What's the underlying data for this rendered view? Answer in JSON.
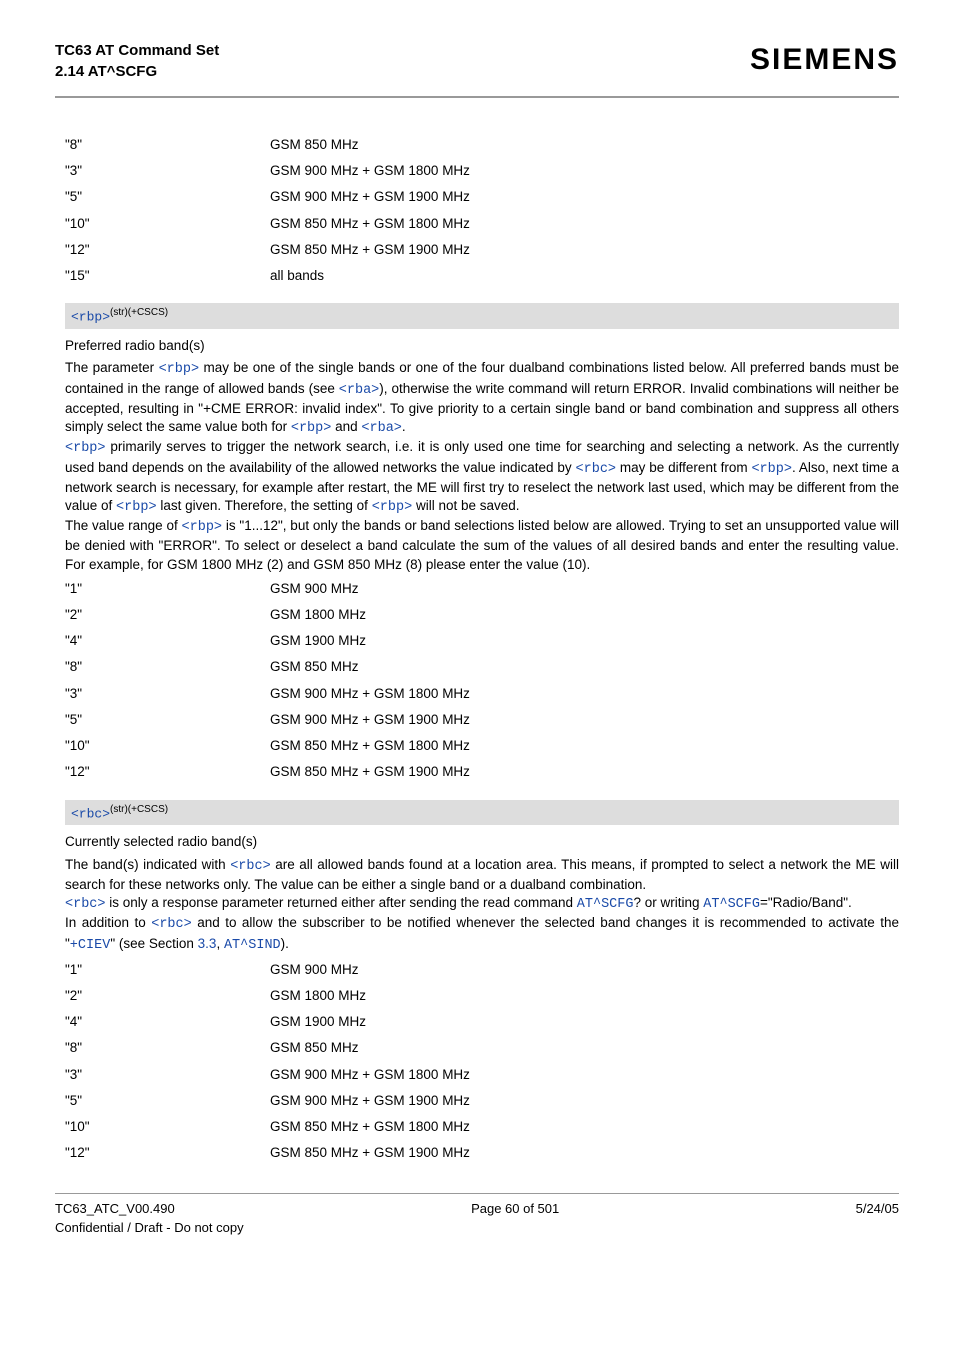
{
  "header": {
    "title1": "TC63 AT Command Set",
    "title2": "2.14 AT^SCFG",
    "brand": "SIEMENS"
  },
  "top_bands": [
    {
      "k": "\"8\"",
      "v": "GSM 850 MHz"
    },
    {
      "k": "\"3\"",
      "v": "GSM 900 MHz + GSM 1800 MHz"
    },
    {
      "k": "\"5\"",
      "v": "GSM 900 MHz + GSM 1900 MHz"
    },
    {
      "k": "\"10\"",
      "v": "GSM 850 MHz + GSM 1800 MHz"
    },
    {
      "k": "\"12\"",
      "v": "GSM 850 MHz + GSM 1900 MHz"
    },
    {
      "k": "\"15\"",
      "v": "all bands"
    }
  ],
  "rbp": {
    "param": "<rbp>",
    "sup": "(str)(+CSCS)",
    "title": "Preferred radio band(s)",
    "p1a": "The parameter ",
    "p1b": " may be one of the single bands or one of the four dualband combinations listed below. All preferred bands must be contained in the range of allowed bands (see ",
    "p1c": "), otherwise the write command will return ERROR. Invalid combinations will neither be accepted, resulting in \"+CME ERROR: invalid index\". To give priority to a certain single band or band combination and suppress all others simply select the same value both for ",
    "p1d": " and ",
    "p1e": ".",
    "p2a": " primarily serves to trigger the network search, i.e. it is only used one time for searching and selecting a network. As the currently used band depends on the availability of the allowed networks the value indicated by ",
    "p2b": " may be different from ",
    "p2c": ". Also, next time a network search is necessary, for example after restart, the ME will first try to reselect the network last used, which may be different from the value of ",
    "p2d": " last given. Therefore, the setting of ",
    "p2e": " will not be saved.",
    "p3a": "The value range of ",
    "p3b": " is \"1...12\", but only the bands or band selections listed below are allowed. Trying to set an unsupported value will be denied with \"ERROR\". To select or deselect a band calculate the sum of the values of all desired bands and enter the resulting value. For example, for GSM 1800 MHz (2) and GSM 850 MHz (8) please enter the value (10).",
    "rbp_ref": "<rbp>",
    "rba_ref": "<rba>",
    "rbc_ref": "<rbc>",
    "bands": [
      {
        "k": "\"1\"",
        "v": "GSM 900 MHz"
      },
      {
        "k": "\"2\"",
        "v": "GSM 1800 MHz"
      },
      {
        "k": "\"4\"",
        "v": "GSM 1900 MHz"
      },
      {
        "k": "\"8\"",
        "v": "GSM 850 MHz"
      },
      {
        "k": "\"3\"",
        "v": "GSM 900 MHz + GSM 1800 MHz"
      },
      {
        "k": "\"5\"",
        "v": "GSM 900 MHz + GSM 1900 MHz"
      },
      {
        "k": "\"10\"",
        "v": "GSM 850 MHz + GSM 1800 MHz"
      },
      {
        "k": "\"12\"",
        "v": "GSM 850 MHz + GSM 1900 MHz"
      }
    ]
  },
  "rbc": {
    "param": "<rbc>",
    "sup": "(str)(+CSCS)",
    "title": "Currently selected radio band(s)",
    "p1a": "The band(s) indicated with ",
    "p1b": " are all allowed bands found at a location area. This means, if prompted to select a network the ME will search for these networks only. The value can be either a single band or a dualband combination.",
    "p2a": " is only a response parameter returned either after sending the read command ",
    "p2b": "? or writing ",
    "p2c": "=\"Radio/Band\".",
    "p3a": "In addition to ",
    "p3b": " and to allow the subscriber to be notified whenever the selected band changes it is recommended to activate the \"",
    "p3c": "\" (see Section ",
    "p3d": ", ",
    "p3e": ").",
    "rbc_ref": "<rbc>",
    "atscfg": "AT^SCFG",
    "ciev": "+CIEV",
    "sec": "3.3",
    "atsind": "AT^SIND",
    "bands": [
      {
        "k": "\"1\"",
        "v": "GSM 900 MHz"
      },
      {
        "k": "\"2\"",
        "v": "GSM 1800 MHz"
      },
      {
        "k": "\"4\"",
        "v": "GSM 1900 MHz"
      },
      {
        "k": "\"8\"",
        "v": "GSM 850 MHz"
      },
      {
        "k": "\"3\"",
        "v": "GSM 900 MHz + GSM 1800 MHz"
      },
      {
        "k": "\"5\"",
        "v": "GSM 900 MHz + GSM 1900 MHz"
      },
      {
        "k": "\"10\"",
        "v": "GSM 850 MHz + GSM 1800 MHz"
      },
      {
        "k": "\"12\"",
        "v": "GSM 850 MHz + GSM 1900 MHz"
      }
    ]
  },
  "footer": {
    "docid": "TC63_ATC_V00.490",
    "page": "Page 60 of 501",
    "date": "5/24/05",
    "conf": "Confidential / Draft - Do not copy"
  }
}
